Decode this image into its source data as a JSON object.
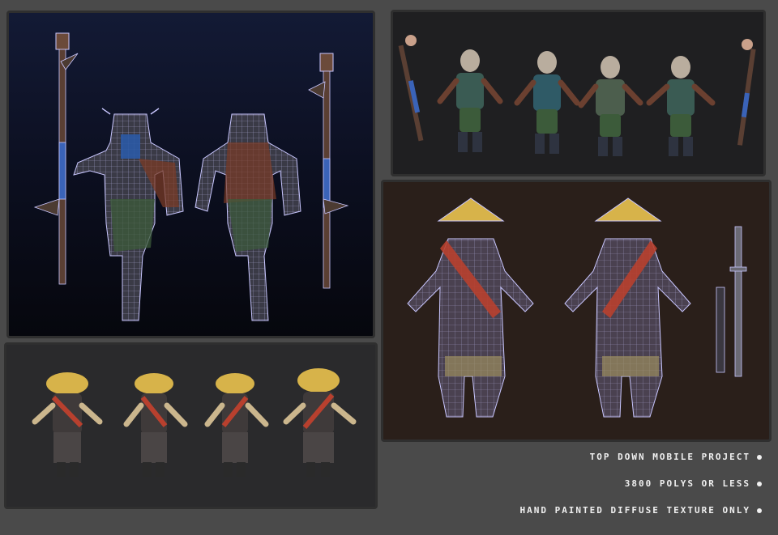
{
  "captions": [
    {
      "text": "TOP DOWN MOBILE PROJECT"
    },
    {
      "text": "3800 POLYS OR LESS"
    },
    {
      "text": "HAND PAINTED DIFFUSE TEXTURE ONLY"
    }
  ],
  "colors": {
    "background": "#4a4a4a",
    "wireframe": "#c9c7ff",
    "hat_gold": "#d7b34a",
    "sash_red": "#b8402e",
    "cloth_green": "#3c5b3a",
    "staff_blue": "#3a63b8"
  }
}
